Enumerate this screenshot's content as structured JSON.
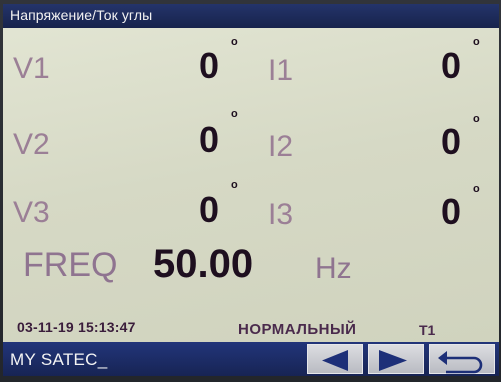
{
  "title": "Напряжение/Ток углы",
  "measurements": {
    "v1": {
      "label": "V1",
      "value": "0",
      "unit": "o"
    },
    "v2": {
      "label": "V2",
      "value": "0",
      "unit": "o"
    },
    "v3": {
      "label": "V3",
      "value": "0",
      "unit": "o"
    },
    "i1": {
      "label": "I1",
      "value": "0",
      "unit": "o"
    },
    "i2": {
      "label": "I2",
      "value": "0",
      "unit": "o"
    },
    "i3": {
      "label": "I3",
      "value": "0",
      "unit": "o"
    }
  },
  "frequency": {
    "label": "FREQ",
    "value": "50.00",
    "unit": "Hz"
  },
  "status": {
    "datetime": "03-11-19 15:13:47",
    "mode": "НОРМАЛЬНЫЙ",
    "tariff": "T1"
  },
  "device": {
    "name": "MY SATEC_"
  },
  "buttons": {
    "prev_icon": "triangle-left-icon",
    "next_icon": "triangle-right-icon",
    "back_icon": "return-arrow-icon"
  },
  "colors": {
    "title_bar": "#1c2a5a",
    "screen_bg": "#d9dcca",
    "label": "#9b7f96",
    "value": "#1e0f1f"
  }
}
